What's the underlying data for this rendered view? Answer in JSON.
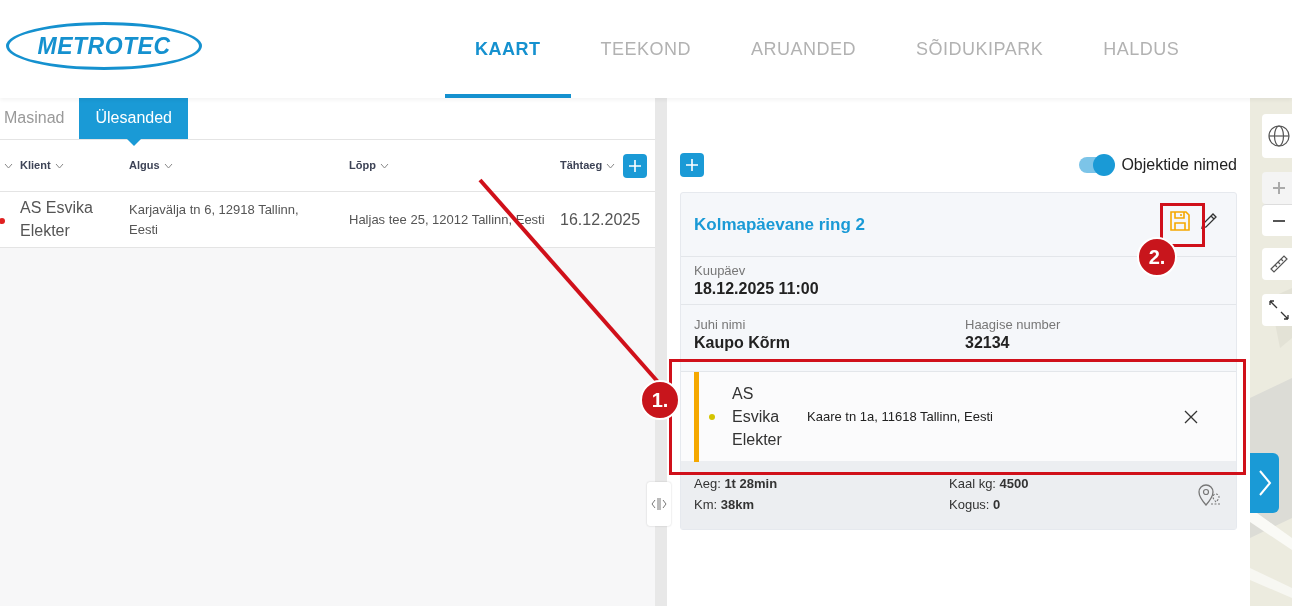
{
  "logo": {
    "text": "METROTEC"
  },
  "nav": [
    {
      "label": "KAART",
      "selected": true
    },
    {
      "label": "TEEKOND",
      "selected": false
    },
    {
      "label": "ARUANDED",
      "selected": false
    },
    {
      "label": "SÕIDUKIPARK",
      "selected": false
    },
    {
      "label": "HALDUS",
      "selected": false
    }
  ],
  "subtabs": [
    {
      "label": "Masinad",
      "selected": false
    },
    {
      "label": "Ülesanded",
      "selected": true
    }
  ],
  "table": {
    "columns": [
      "Klient",
      "Algus",
      "Lõpp",
      "Tähtaeg"
    ],
    "rows": [
      {
        "color": "#e02020",
        "cells": [
          "AS Esvika Elekter",
          "Karjavälja tn 6, 12918 Tallinn, Eesti",
          "Haljas tee 25, 12012 Tallinn, Eesti",
          "16.12.2025"
        ]
      }
    ]
  },
  "route_panel": {
    "toggle": {
      "label": "Objektide nimed",
      "on": true
    },
    "card": {
      "title": "Kolmapäevane ring 2",
      "fields": [
        {
          "label": "Kuupäev",
          "value": "18.12.2025 11:00"
        },
        {
          "label": "Juhi nimi",
          "value": "Kaupo Kõrm"
        },
        {
          "label": "Haagise number",
          "value": "32134"
        }
      ],
      "stops": [
        {
          "client": "AS Esvika Elekter",
          "address": "Kaare tn 1a, 11618 Tallinn, Eesti",
          "color": "#d4c400"
        }
      ],
      "stats": [
        {
          "label": "Aeg:",
          "value": "1t 28min"
        },
        {
          "label": "Kaal kg:",
          "value": "4500"
        },
        {
          "label": "Km:",
          "value": "38km"
        },
        {
          "label": "Kogus:",
          "value": "0"
        }
      ]
    }
  },
  "annotations": [
    {
      "label": "1."
    },
    {
      "label": "2."
    }
  ]
}
